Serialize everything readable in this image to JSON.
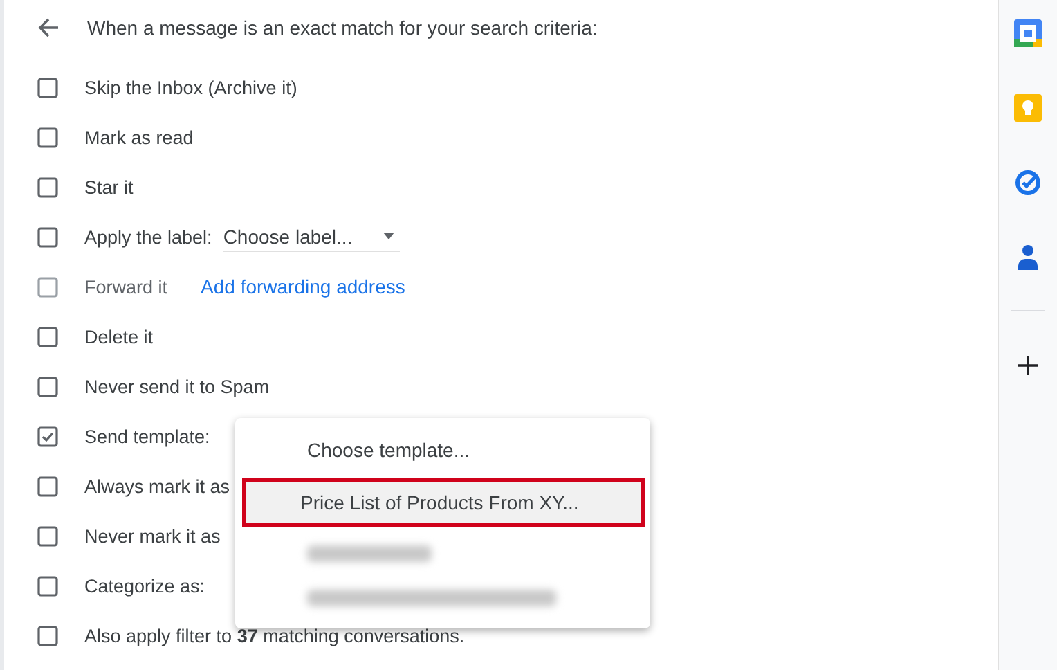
{
  "header": {
    "title": "When a message is an exact match for your search criteria:"
  },
  "options": [
    {
      "kind": "plain",
      "label": "Skip the Inbox (Archive it)",
      "checked": false,
      "disabled": false
    },
    {
      "kind": "plain",
      "label": "Mark as read",
      "checked": false,
      "disabled": false
    },
    {
      "kind": "plain",
      "label": "Star it",
      "checked": false,
      "disabled": false
    },
    {
      "kind": "dropdown",
      "label": "Apply the label:",
      "value": "Choose label...",
      "checked": false,
      "disabled": false
    },
    {
      "kind": "link",
      "label": "Forward it",
      "link": "Add forwarding address",
      "checked": false,
      "disabled": true
    },
    {
      "kind": "plain",
      "label": "Delete it",
      "checked": false,
      "disabled": false
    },
    {
      "kind": "plain",
      "label": "Never send it to Spam",
      "checked": false,
      "disabled": false
    },
    {
      "kind": "plain",
      "label": "Send template:",
      "checked": true,
      "disabled": false
    },
    {
      "kind": "plain",
      "label": "Always mark it as",
      "checked": false,
      "disabled": false
    },
    {
      "kind": "plain",
      "label": "Never mark it as",
      "checked": false,
      "disabled": false
    },
    {
      "kind": "plain",
      "label": "Categorize as:",
      "checked": false,
      "disabled": false
    },
    {
      "kind": "rich",
      "label": "Also apply filter to **37** matching conversations.",
      "checked": false,
      "disabled": false
    }
  ],
  "template_menu": {
    "items": [
      {
        "kind": "text",
        "label": "Choose template...",
        "selected": false
      },
      {
        "kind": "text",
        "label": "Price List of Products From XY...",
        "selected": true
      },
      {
        "kind": "blurred",
        "selected": false
      },
      {
        "kind": "blurred",
        "selected": false
      }
    ]
  }
}
